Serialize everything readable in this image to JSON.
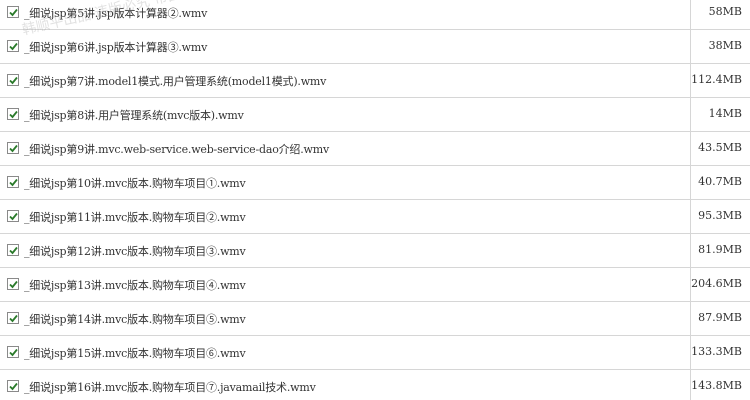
{
  "files": [
    {
      "name": "_细说jsp第5讲.jsp版本计算器②.wmv",
      "size": "58MB",
      "checked": true
    },
    {
      "name": "_细说jsp第6讲.jsp版本计算器③.wmv",
      "size": "38MB",
      "checked": true
    },
    {
      "name": "_细说jsp第7讲.model1模式.用户管理系统(model1模式).wmv",
      "size": "112.4MB",
      "checked": true
    },
    {
      "name": "_细说jsp第8讲.用户管理系统(mvc版本).wmv",
      "size": "14MB",
      "checked": true
    },
    {
      "name": "_细说jsp第9讲.mvc.web-service.web-service-dao介绍.wmv",
      "size": "43.5MB",
      "checked": true
    },
    {
      "name": "_细说jsp第10讲.mvc版本.购物车项目①.wmv",
      "size": "40.7MB",
      "checked": true
    },
    {
      "name": "_细说jsp第11讲.mvc版本.购物车项目②.wmv",
      "size": "95.3MB",
      "checked": true
    },
    {
      "name": "_细说jsp第12讲.mvc版本.购物车项目③.wmv",
      "size": "81.9MB",
      "checked": true
    },
    {
      "name": "_细说jsp第13讲.mvc版本.购物车项目④.wmv",
      "size": "204.6MB",
      "checked": true
    },
    {
      "name": "_细说jsp第14讲.mvc版本.购物车项目⑤.wmv",
      "size": "87.9MB",
      "checked": true
    },
    {
      "name": "_细说jsp第15讲.mvc版本.购物车项目⑥.wmv",
      "size": "133.3MB",
      "checked": true
    },
    {
      "name": "_细说jsp第16讲.mvc版本.购物车项目⑦.javamail技术.wmv",
      "size": "143.8MB",
      "checked": true
    }
  ],
  "watermark": "韩顺平出品 违版必究 帝国动力",
  "colors": {
    "check": "#2a7a2a",
    "text": "#333333",
    "border": "#d6d6d6"
  },
  "icons": {
    "checkbox_checked": "checkmark-icon"
  }
}
